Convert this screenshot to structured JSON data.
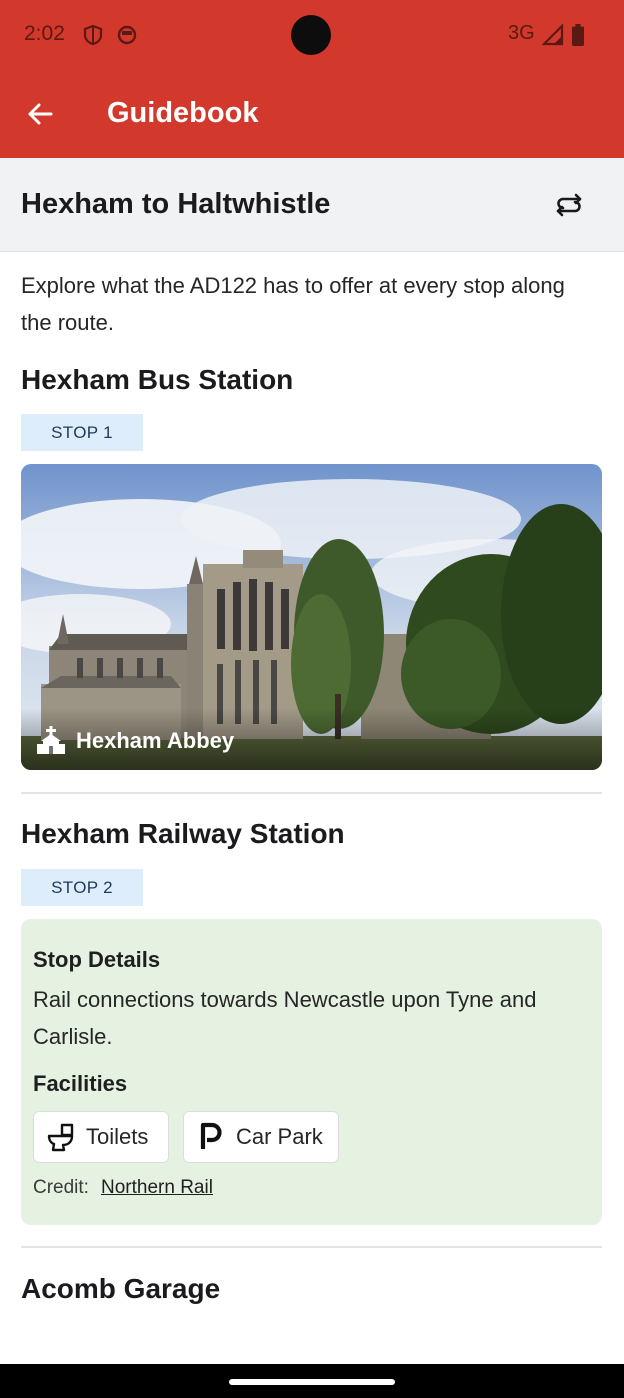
{
  "status_bar": {
    "time": "2:02",
    "network": "3G"
  },
  "app_bar": {
    "title": "Guidebook",
    "color": "#d3382c"
  },
  "route": {
    "title": "Hexham to Haltwhistle"
  },
  "intro": "Explore what the AD122 has to offer at every stop along the route.",
  "stops": [
    {
      "name": "Hexham Bus Station",
      "badge": "STOP 1",
      "attraction": {
        "label": "Hexham Abbey",
        "icon": "church-icon"
      }
    },
    {
      "name": "Hexham Railway Station",
      "badge": "STOP 2",
      "details": {
        "heading": "Stop Details",
        "text": "Rail connections towards Newcastle upon Tyne and Carlisle.",
        "facilities_heading": "Facilities",
        "facilities": [
          {
            "label": "Toilets",
            "icon": "toilet-icon"
          },
          {
            "label": "Car Park",
            "icon": "parking-icon"
          }
        ],
        "credit_label": "Credit:",
        "credit_link": "Northern Rail"
      }
    },
    {
      "name": "Acomb Garage"
    }
  ]
}
